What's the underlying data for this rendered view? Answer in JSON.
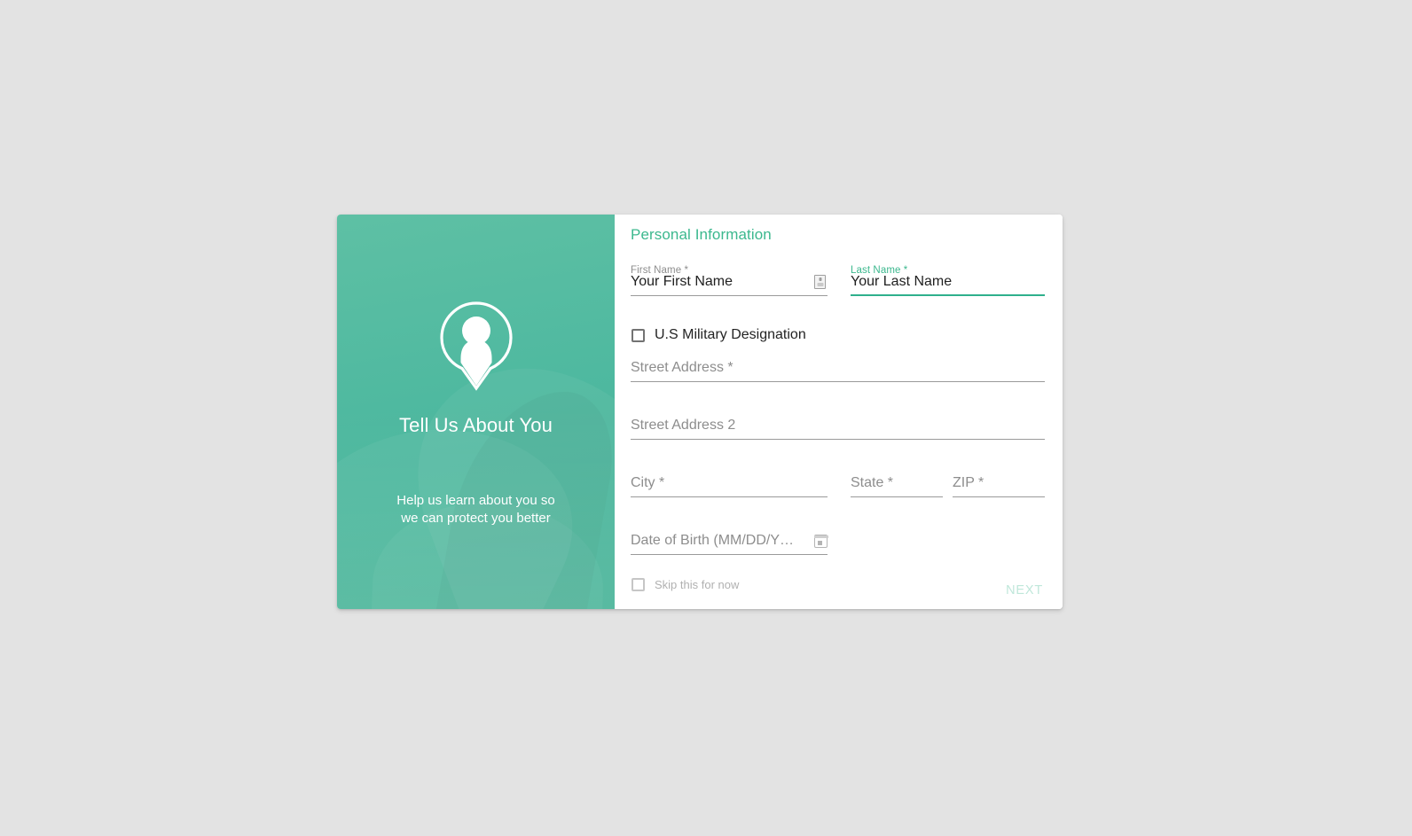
{
  "hero": {
    "icon": "person-pin-icon",
    "title": "Tell Us About You",
    "subtitle": "Help us learn about you so\nwe can protect you better"
  },
  "form": {
    "section_title": "Personal Information",
    "fields": {
      "first_name": {
        "label": "First Name *",
        "value": "Your First Name",
        "icon": "autofill-contact-icon",
        "focused": false
      },
      "last_name": {
        "label": "Last Name *",
        "value": "Your Last Name",
        "focused": true
      },
      "street_address": {
        "placeholder": "Street Address *"
      },
      "street_address_2": {
        "placeholder": "Street Address 2"
      },
      "city": {
        "placeholder": "City *"
      },
      "state": {
        "placeholder": "State *"
      },
      "zip": {
        "placeholder": "ZIP *"
      },
      "date_of_birth": {
        "placeholder": "Date of Birth (MM/DD/YY…",
        "icon": "calendar-icon"
      }
    },
    "checkboxes": {
      "military": {
        "label": "U.S Military Designation",
        "checked": false
      },
      "skip": {
        "label": "Skip this for now",
        "checked": false
      }
    },
    "next_label": "NEXT"
  },
  "colors": {
    "accent_green": "#3cb88e",
    "hero_green": "#4fb9a0",
    "next_disabled": "#bfe7da",
    "page_background": "#e3e3e3"
  }
}
